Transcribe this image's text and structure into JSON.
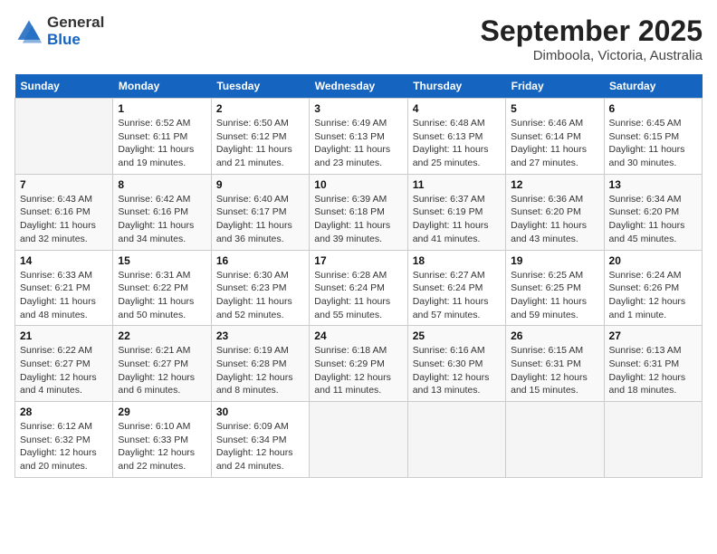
{
  "header": {
    "logo_general": "General",
    "logo_blue": "Blue",
    "month": "September 2025",
    "location": "Dimboola, Victoria, Australia"
  },
  "weekdays": [
    "Sunday",
    "Monday",
    "Tuesday",
    "Wednesday",
    "Thursday",
    "Friday",
    "Saturday"
  ],
  "weeks": [
    [
      {
        "day": "",
        "text": ""
      },
      {
        "day": "1",
        "text": "Sunrise: 6:52 AM\nSunset: 6:11 PM\nDaylight: 11 hours and 19 minutes."
      },
      {
        "day": "2",
        "text": "Sunrise: 6:50 AM\nSunset: 6:12 PM\nDaylight: 11 hours and 21 minutes."
      },
      {
        "day": "3",
        "text": "Sunrise: 6:49 AM\nSunset: 6:13 PM\nDaylight: 11 hours and 23 minutes."
      },
      {
        "day": "4",
        "text": "Sunrise: 6:48 AM\nSunset: 6:13 PM\nDaylight: 11 hours and 25 minutes."
      },
      {
        "day": "5",
        "text": "Sunrise: 6:46 AM\nSunset: 6:14 PM\nDaylight: 11 hours and 27 minutes."
      },
      {
        "day": "6",
        "text": "Sunrise: 6:45 AM\nSunset: 6:15 PM\nDaylight: 11 hours and 30 minutes."
      }
    ],
    [
      {
        "day": "7",
        "text": "Sunrise: 6:43 AM\nSunset: 6:16 PM\nDaylight: 11 hours and 32 minutes."
      },
      {
        "day": "8",
        "text": "Sunrise: 6:42 AM\nSunset: 6:16 PM\nDaylight: 11 hours and 34 minutes."
      },
      {
        "day": "9",
        "text": "Sunrise: 6:40 AM\nSunset: 6:17 PM\nDaylight: 11 hours and 36 minutes."
      },
      {
        "day": "10",
        "text": "Sunrise: 6:39 AM\nSunset: 6:18 PM\nDaylight: 11 hours and 39 minutes."
      },
      {
        "day": "11",
        "text": "Sunrise: 6:37 AM\nSunset: 6:19 PM\nDaylight: 11 hours and 41 minutes."
      },
      {
        "day": "12",
        "text": "Sunrise: 6:36 AM\nSunset: 6:20 PM\nDaylight: 11 hours and 43 minutes."
      },
      {
        "day": "13",
        "text": "Sunrise: 6:34 AM\nSunset: 6:20 PM\nDaylight: 11 hours and 45 minutes."
      }
    ],
    [
      {
        "day": "14",
        "text": "Sunrise: 6:33 AM\nSunset: 6:21 PM\nDaylight: 11 hours and 48 minutes."
      },
      {
        "day": "15",
        "text": "Sunrise: 6:31 AM\nSunset: 6:22 PM\nDaylight: 11 hours and 50 minutes."
      },
      {
        "day": "16",
        "text": "Sunrise: 6:30 AM\nSunset: 6:23 PM\nDaylight: 11 hours and 52 minutes."
      },
      {
        "day": "17",
        "text": "Sunrise: 6:28 AM\nSunset: 6:24 PM\nDaylight: 11 hours and 55 minutes."
      },
      {
        "day": "18",
        "text": "Sunrise: 6:27 AM\nSunset: 6:24 PM\nDaylight: 11 hours and 57 minutes."
      },
      {
        "day": "19",
        "text": "Sunrise: 6:25 AM\nSunset: 6:25 PM\nDaylight: 11 hours and 59 minutes."
      },
      {
        "day": "20",
        "text": "Sunrise: 6:24 AM\nSunset: 6:26 PM\nDaylight: 12 hours and 1 minute."
      }
    ],
    [
      {
        "day": "21",
        "text": "Sunrise: 6:22 AM\nSunset: 6:27 PM\nDaylight: 12 hours and 4 minutes."
      },
      {
        "day": "22",
        "text": "Sunrise: 6:21 AM\nSunset: 6:27 PM\nDaylight: 12 hours and 6 minutes."
      },
      {
        "day": "23",
        "text": "Sunrise: 6:19 AM\nSunset: 6:28 PM\nDaylight: 12 hours and 8 minutes."
      },
      {
        "day": "24",
        "text": "Sunrise: 6:18 AM\nSunset: 6:29 PM\nDaylight: 12 hours and 11 minutes."
      },
      {
        "day": "25",
        "text": "Sunrise: 6:16 AM\nSunset: 6:30 PM\nDaylight: 12 hours and 13 minutes."
      },
      {
        "day": "26",
        "text": "Sunrise: 6:15 AM\nSunset: 6:31 PM\nDaylight: 12 hours and 15 minutes."
      },
      {
        "day": "27",
        "text": "Sunrise: 6:13 AM\nSunset: 6:31 PM\nDaylight: 12 hours and 18 minutes."
      }
    ],
    [
      {
        "day": "28",
        "text": "Sunrise: 6:12 AM\nSunset: 6:32 PM\nDaylight: 12 hours and 20 minutes."
      },
      {
        "day": "29",
        "text": "Sunrise: 6:10 AM\nSunset: 6:33 PM\nDaylight: 12 hours and 22 minutes."
      },
      {
        "day": "30",
        "text": "Sunrise: 6:09 AM\nSunset: 6:34 PM\nDaylight: 12 hours and 24 minutes."
      },
      {
        "day": "",
        "text": ""
      },
      {
        "day": "",
        "text": ""
      },
      {
        "day": "",
        "text": ""
      },
      {
        "day": "",
        "text": ""
      }
    ]
  ]
}
